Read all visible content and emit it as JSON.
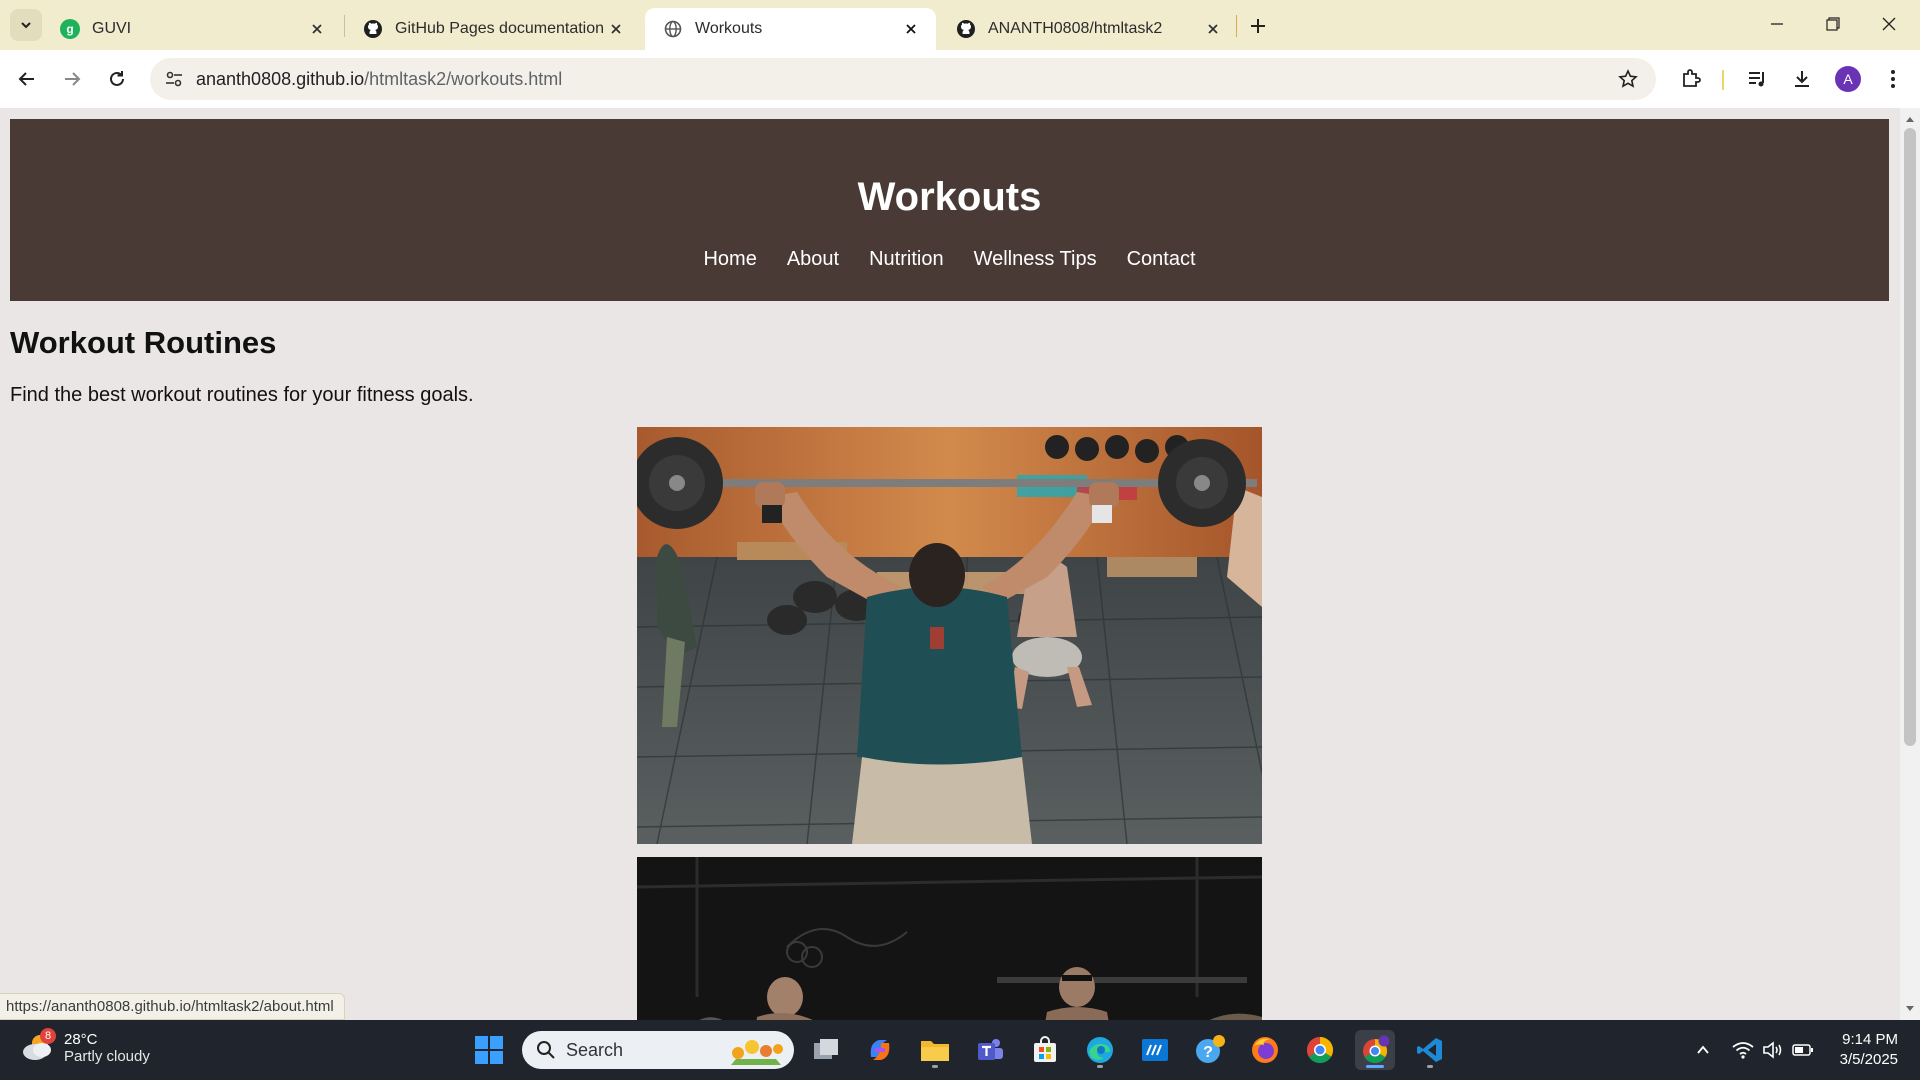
{
  "browser": {
    "tabs": [
      {
        "title": "GUVI",
        "active": false
      },
      {
        "title": "GitHub Pages documentation -",
        "active": false
      },
      {
        "title": "Workouts",
        "active": true
      },
      {
        "title": "ANANTH0808/htmltask2",
        "active": false
      }
    ],
    "url_host": "ananth0808.github.io",
    "url_path": "/htmltask2/workouts.html",
    "profile_initial": "A",
    "status_url": "https://ananth0808.github.io/htmltask2/about.html"
  },
  "page": {
    "header_title": "Workouts",
    "nav": [
      "Home",
      "About",
      "Nutrition",
      "Wellness Tips",
      "Contact"
    ],
    "section_title": "Workout Routines",
    "section_text": "Find the best workout routines for your fitness goals."
  },
  "taskbar": {
    "weather_temp": "28°C",
    "weather_desc": "Partly cloudy",
    "weather_badge": "8",
    "search_label": "Search",
    "time": "9:14 PM",
    "date": "3/5/2025"
  },
  "colors": {
    "header_bg": "#4a3a35",
    "page_bg": "#e9e6e5",
    "tabstrip_bg": "#f2eccf",
    "taskbar_bg": "#20252d"
  }
}
